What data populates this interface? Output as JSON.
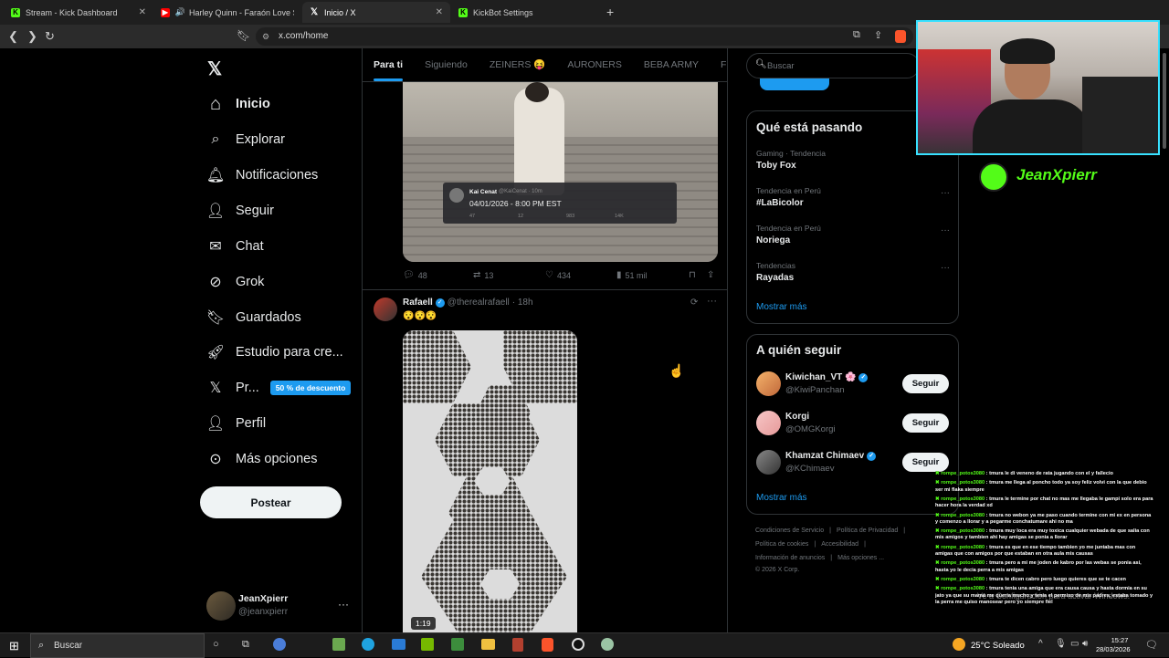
{
  "browser": {
    "tabs": [
      {
        "title": "Stream - Kick Dashboard",
        "icon": "kick-icon"
      },
      {
        "title": "Harley Quinn - Faraón Love Shad",
        "icon": "youtube-icon"
      },
      {
        "title": "Inicio / X",
        "icon": "x-icon"
      },
      {
        "title": "KickBot Settings",
        "icon": "kick-icon"
      }
    ],
    "url": "x.com/home",
    "new_tab": "+"
  },
  "sidebar": {
    "items": [
      {
        "label": "Inicio",
        "icon": "home-icon"
      },
      {
        "label": "Explorar",
        "icon": "search-icon"
      },
      {
        "label": "Notificaciones",
        "icon": "bell-icon"
      },
      {
        "label": "Seguir",
        "icon": "person-add-icon"
      },
      {
        "label": "Chat",
        "icon": "mail-icon"
      },
      {
        "label": "Grok",
        "icon": "grok-icon"
      },
      {
        "label": "Guardados",
        "icon": "bookmark-icon"
      },
      {
        "label": "Estudio para cre...",
        "icon": "rocket-icon"
      },
      {
        "label": "Pr...",
        "icon": "x-icon"
      },
      {
        "label": "Perfil",
        "icon": "user-icon"
      },
      {
        "label": "Más opciones",
        "icon": "more-circle-icon"
      }
    ],
    "promo_badge": "50 % de descuento",
    "post_button": "Postear",
    "account": {
      "name": "JeanXpierr",
      "handle": "@jeanxpierr"
    }
  },
  "timeline": {
    "tabs": [
      "Para ti",
      "Siguiendo",
      "ZEINERS 😝",
      "AURONERS",
      "BEBA ARMY",
      "Fiel Arm"
    ],
    "post1": {
      "embed_name": "Kai Cenat",
      "embed_handle": "@KaiCenat · 10m",
      "embed_text": "04/01/2026 - 8:00 PM EST",
      "embed_stats": [
        "47",
        "12",
        "983",
        "14K"
      ],
      "replies": "48",
      "reposts": "13",
      "likes": "434",
      "views": "51 mil"
    },
    "post2": {
      "name": "Rafaell",
      "handle": "@therealrafaell",
      "time": "· 18h",
      "text": "😯😯😯",
      "video_duration": "1:19"
    }
  },
  "right": {
    "search_placeholder": "Buscar",
    "trends_title": "Qué está pasando",
    "trends": [
      {
        "meta": "Gaming · Tendencia",
        "name": "Toby Fox"
      },
      {
        "meta": "Tendencia en Perú",
        "name": "#LaBicolor"
      },
      {
        "meta": "Tendencia en Perú",
        "name": "Noriega"
      },
      {
        "meta": "Tendencias",
        "name": "Rayadas"
      }
    ],
    "show_more": "Mostrar más",
    "follow_title": "A quién seguir",
    "follow": [
      {
        "name": "Kiwichan_VT 🌸",
        "handle": "@KiwiPanchan",
        "button": "Seguir"
      },
      {
        "name": "Korgi",
        "handle": "@OMGKorgi",
        "button": "Seguir"
      },
      {
        "name": "Khamzat Chimaev",
        "handle": "@KChimaev",
        "button": "Seguir"
      }
    ],
    "footer": {
      "line1": [
        "Condiciones de Servicio",
        "Política de Privacidad"
      ],
      "line2": [
        "Política de cookies",
        "Accesibilidad"
      ],
      "line3": [
        "Información de anuncios",
        "Más opciones ..."
      ],
      "copyright": "© 2026 X Corp."
    }
  },
  "stream_overlay": {
    "streamer_name": "JeanXpierr",
    "watermark_line1": "Ve a Configuración para activar Windows.",
    "chat": [
      {
        "user": "rompe_potos3080",
        "text": "tmura le di veneno de rata jugando con el y fallecio"
      },
      {
        "user": "rompe_potos3080",
        "text": "tmura me llega al poncho todo ya soy feliz volvi con la que debio ser mi flaka siempre"
      },
      {
        "user": "rompe_potos3080",
        "text": "tmura le termine por chat no mas me llegaba le gampi solo era para hacer hora la verdad xd"
      },
      {
        "user": "rompe_potos3080",
        "text": "tmura no webon ya me paso cuando termine con mi ex en persona y comenzo a llorar y a pegarme conchatumare ahi no ma"
      },
      {
        "user": "rompe_potos3080",
        "text": "tmura muy loca era muy toxica cualquier webada de que salia con mis amigos y tambien ahi hay amigas se ponia a llorar"
      },
      {
        "user": "rompe_potos3080",
        "text": "tmura es que en ese tiempo tambien yo me juntaba mas con amigas que con amigos por que estaban en otra aula mis causas"
      },
      {
        "user": "rompe_potos3080",
        "text": "tmura pero a mi me joden de kabro por las webas se ponia asi, hasta yo le decia perra a mis amigas"
      },
      {
        "user": "rompe_potos3080",
        "text": "tmura te dicen cabro pero luego quieres que se te cacen"
      },
      {
        "user": "rompe_potos3080",
        "text": "tmura tenia una amiga que era causa causa y hasta dormia en su jato ya que su mamá me queria mucho y tenia el permiso de mis padres, estaba tomado y la perra me quiso manosear pero yo siempre fiel"
      }
    ]
  },
  "taskbar": {
    "search": "Buscar",
    "weather": "25°C  Soleado",
    "time": "15:27",
    "date": "28/03/2026"
  },
  "colors": {
    "accent": "#1d9bf0",
    "kick": "#53fc18",
    "bg": "#000000"
  }
}
